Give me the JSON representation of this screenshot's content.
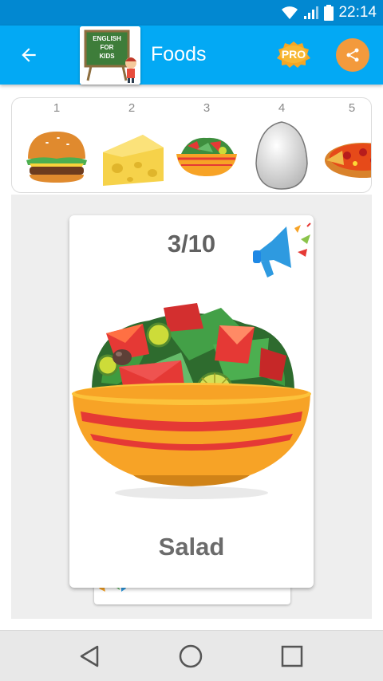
{
  "status_bar": {
    "time": "22:14"
  },
  "app_bar": {
    "title": "Foods",
    "logo_text": [
      "ENGLISH",
      "FOR",
      "KIDS"
    ],
    "pro_label": "PRO"
  },
  "thumbnails": [
    {
      "number": "1",
      "icon": "hamburger-icon"
    },
    {
      "number": "2",
      "icon": "cheese-icon"
    },
    {
      "number": "3",
      "icon": "salad-icon"
    },
    {
      "number": "4",
      "icon": "egg-icon"
    },
    {
      "number": "5",
      "icon": "pizza-icon"
    }
  ],
  "card": {
    "counter": "3/10",
    "word": "Salad",
    "image": "salad-bowl-image"
  },
  "colors": {
    "status_bar": "#0288d1",
    "app_bar": "#03a9f4",
    "share_button": "#f39a3c",
    "sound_icon": "#2e9ae0",
    "card_text": "#616161"
  }
}
